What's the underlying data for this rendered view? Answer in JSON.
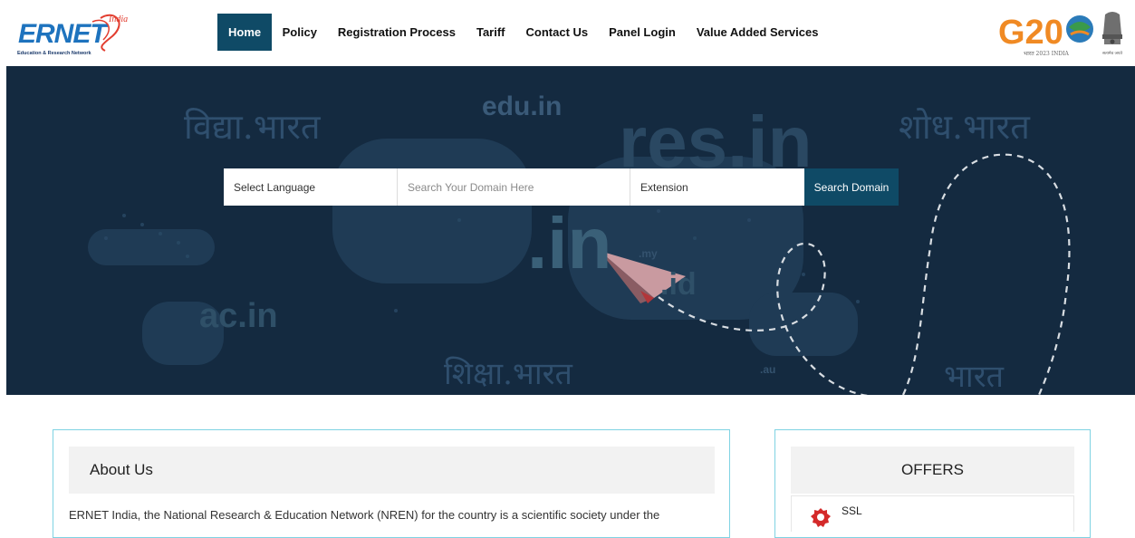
{
  "header": {
    "logo_text": "ERNET",
    "logo_india": "India",
    "logo_tagline": "Education & Research Network",
    "g20_text": "G20",
    "g20_caption": "भारत 2023 INDIA",
    "emblem_caption": "सत्यमेव जयते"
  },
  "nav": {
    "items": [
      {
        "label": "Home",
        "active": true
      },
      {
        "label": "Policy"
      },
      {
        "label": "Registration Process"
      },
      {
        "label": "Tariff"
      },
      {
        "label": "Contact Us"
      },
      {
        "label": "Panel Login"
      },
      {
        "label": "Value Added Services"
      }
    ]
  },
  "hero": {
    "domains": {
      "vidya": "विद्या.भारत",
      "edu": "edu.in",
      "res": "res.in",
      "shodh": "शोध.भारत",
      "in": ".in",
      "ac": "ac.in",
      "shiksha": "शिक्षा.भारत",
      "bharat": "भारत",
      "my": ".my",
      "id": ".id",
      "au": ".au"
    }
  },
  "search": {
    "language_label": "Select Language",
    "domain_placeholder": "Search Your Domain Here",
    "extension_label": "Extension",
    "button_label": "Search Domain"
  },
  "about": {
    "title": "About Us",
    "text": "ERNET India, the National Research & Education Network (NREN) for the country is a scientific society under the"
  },
  "offers": {
    "title": "OFFERS",
    "items": [
      {
        "label": "SSL"
      }
    ]
  },
  "colors": {
    "nav_active": "#0f4a66",
    "hero_bg": "#142a40",
    "panel_border": "#7fd3e3",
    "brand_blue": "#1e73be",
    "brand_red": "#e23d2f"
  }
}
